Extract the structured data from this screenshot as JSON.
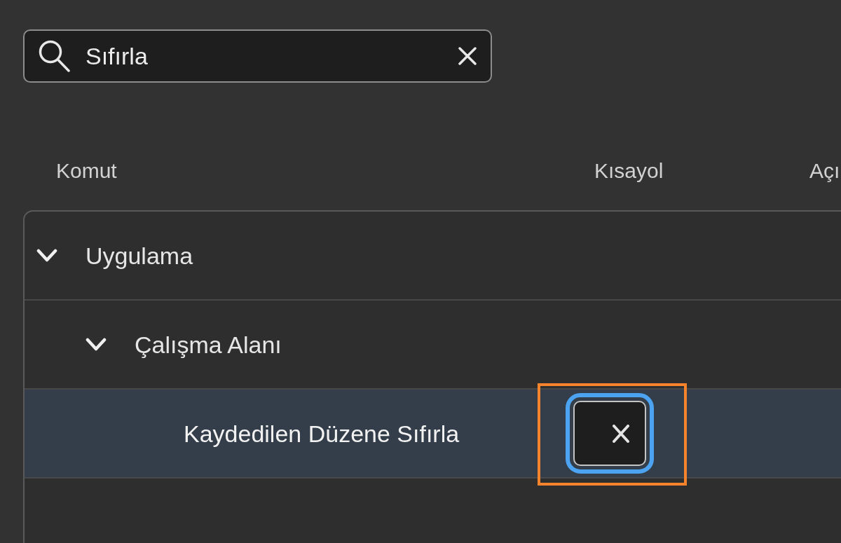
{
  "search": {
    "value": "Sıfırla"
  },
  "table": {
    "columns": [
      "Komut",
      "Kısayol",
      "Açı"
    ],
    "rows": [
      {
        "label": "Uygulama",
        "expanded": true,
        "selected": false,
        "children": [
          {
            "label": "Çalışma Alanı",
            "expanded": true,
            "selected": false,
            "children": [
              {
                "label": "Kaydedilen Düzene Sıfırla",
                "selected": true,
                "shortcut": {
                  "focused": true,
                  "highlighted": true
                }
              }
            ]
          }
        ]
      }
    ]
  }
}
